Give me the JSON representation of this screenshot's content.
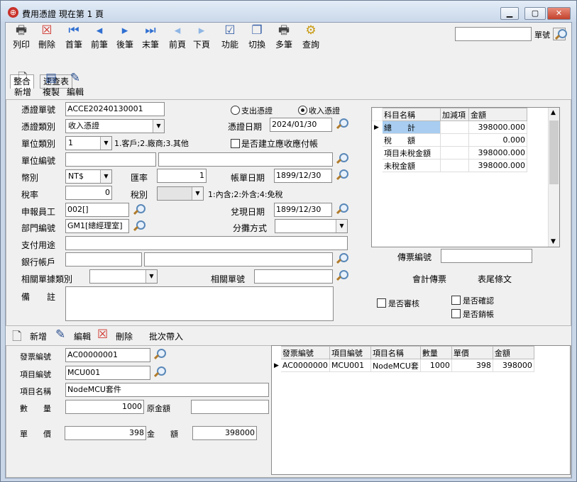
{
  "window": {
    "title": "費用憑證  現在第 1 頁"
  },
  "toolbar": [
    {
      "label": "列印",
      "icon": "print-icon"
    },
    {
      "label": "刪除",
      "icon": "delete-icon"
    },
    {
      "label": "首筆",
      "icon": "first-record-icon"
    },
    {
      "label": "前筆",
      "icon": "prev-record-icon"
    },
    {
      "label": "後筆",
      "icon": "next-record-icon"
    },
    {
      "label": "末筆",
      "icon": "last-record-icon"
    },
    {
      "label": "前頁",
      "icon": "prev-page-icon"
    },
    {
      "label": "下頁",
      "icon": "next-page-icon"
    },
    {
      "label": "功能",
      "icon": "function-icon"
    },
    {
      "label": "切換",
      "icon": "switch-icon"
    },
    {
      "label": "多筆",
      "icon": "multi-record-icon"
    },
    {
      "label": "查詢",
      "icon": "query-icon"
    }
  ],
  "search": {
    "value": "",
    "label": "單號"
  },
  "tabs": [
    "整合",
    "速查表"
  ],
  "subtoolbar": [
    "新增",
    "複製",
    "編輯"
  ],
  "header": {
    "voucher_no_label": "憑證單號",
    "voucher_no": "ACCE20240130001",
    "expense_radio": "支出憑證",
    "income_radio": "收入憑證",
    "voucher_type_label": "憑證類別",
    "voucher_type": "收入憑證",
    "voucher_date_label": "憑證日期",
    "voucher_date": "2024/01/30",
    "unit_type_label": "單位類別",
    "unit_type": "1",
    "unit_type_hint": "1.客戶;2.廠商;3.其他",
    "create_ar_label": "是否建立應收應付帳",
    "unit_no_label": "單位編號",
    "unit_no": "",
    "unit_name": "",
    "currency_label": "幣別",
    "currency": "NT$",
    "rate_label": "匯率",
    "rate": "1",
    "bill_date_label": "帳單日期",
    "bill_date": "1899/12/30",
    "tax_rate_label": "稅率",
    "tax_rate": "0",
    "tax_type_label": "稅別",
    "tax_type": "",
    "tax_type_hint": "1:內含;2:外含;4:免稅",
    "applicant_label": "申報員工",
    "applicant": "002[]",
    "cash_date_label": "兌現日期",
    "cash_date": "1899/12/30",
    "dept_label": "部門編號",
    "dept": "GM1[總經理室]",
    "allocation_label": "分攤方式",
    "allocation": "",
    "purpose_label": "支付用途",
    "purpose": "",
    "bank_label": "銀行帳戶",
    "bank": "",
    "bank_name": "",
    "ref_type_label": "相關單據類別",
    "ref_type": "",
    "ref_no_label": "相關單號",
    "ref_no": "",
    "remark_label": "備　　註",
    "remark": ""
  },
  "summary_grid": {
    "columns": [
      "科目名稱",
      "加減項",
      "金額"
    ],
    "rows": [
      {
        "name": "總　　計",
        "sign": "",
        "amount": "398000.000"
      },
      {
        "name": "稅　　額",
        "sign": "",
        "amount": "0.000"
      },
      {
        "name": "項目未稅金額",
        "sign": "",
        "amount": "398000.000"
      },
      {
        "name": "未稅金額",
        "sign": "",
        "amount": "398000.000"
      }
    ]
  },
  "right": {
    "slip_no_label": "傳票編號",
    "slip_no": "",
    "acc_slip": "會計傳票",
    "tail_text": "表尾條文",
    "review": "是否審核",
    "confirm": "是否確認",
    "close": "是否銷帳"
  },
  "detail_toolbar": [
    "新增",
    "編輯",
    "刪除",
    "批次帶入"
  ],
  "detail": {
    "invoice_label": "發票編號",
    "invoice": "AC00000001",
    "item_no_label": "項目編號",
    "item_no": "MCU001",
    "item_name_label": "項目名稱",
    "item_name": "NodeMCU套件",
    "qty_label": "數　　量",
    "qty": "1000",
    "orig_amount_label": "原金額",
    "orig_amount": "",
    "price_label": "單　　價",
    "price": "398",
    "amount_label": "金　　額",
    "amount": "398000"
  },
  "detail_grid": {
    "columns": [
      "發票編號",
      "項目編號",
      "項目名稱",
      "數量",
      "單價",
      "金額"
    ],
    "rows": [
      {
        "invoice": "AC0000000",
        "item_no": "MCU001",
        "item_name": "NodeMCU套",
        "qty": "1000",
        "price": "398",
        "amount": "398000"
      }
    ]
  }
}
